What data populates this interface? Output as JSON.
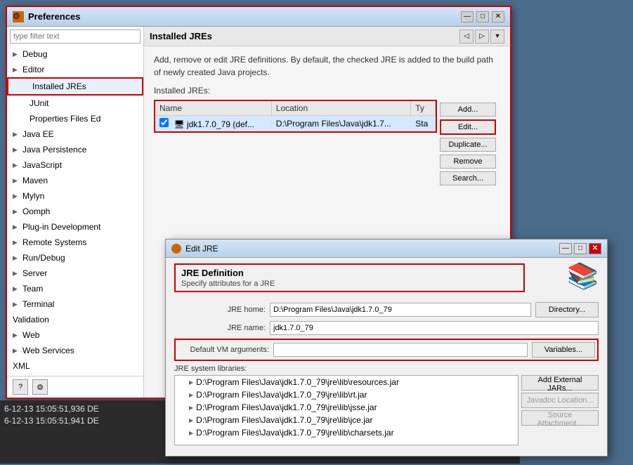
{
  "preferences_window": {
    "title": "Preferences",
    "title_icon": "⚙",
    "min_btn": "—",
    "max_btn": "□",
    "close_btn": "✕"
  },
  "filter": {
    "placeholder": "type filter text"
  },
  "sidebar": {
    "items": [
      {
        "id": "debug",
        "label": "Debug",
        "level": 0,
        "has_arrow": true,
        "arrow": "▶",
        "selected": false
      },
      {
        "id": "editor",
        "label": "Editor",
        "level": 0,
        "has_arrow": true,
        "arrow": "▶",
        "selected": false
      },
      {
        "id": "installed-jres",
        "label": "Installed JREs",
        "level": 1,
        "has_arrow": false,
        "arrow": "",
        "selected": false,
        "highlighted": true
      },
      {
        "id": "junit",
        "label": "JUnit",
        "level": 2,
        "has_arrow": false,
        "arrow": "",
        "selected": false
      },
      {
        "id": "properties-files",
        "label": "Properties Files Ed",
        "level": 2,
        "has_arrow": false,
        "arrow": "",
        "selected": false
      },
      {
        "id": "java-ee",
        "label": "Java EE",
        "level": 0,
        "has_arrow": true,
        "arrow": "▶",
        "selected": false
      },
      {
        "id": "java-persistence",
        "label": "Java Persistence",
        "level": 0,
        "has_arrow": true,
        "arrow": "▶",
        "selected": false
      },
      {
        "id": "javascript",
        "label": "JavaScript",
        "level": 0,
        "has_arrow": true,
        "arrow": "▶",
        "selected": false
      },
      {
        "id": "maven",
        "label": "Maven",
        "level": 0,
        "has_arrow": true,
        "arrow": "▶",
        "selected": false
      },
      {
        "id": "mylyn",
        "label": "Mylyn",
        "level": 0,
        "has_arrow": true,
        "arrow": "▶",
        "selected": false
      },
      {
        "id": "oomph",
        "label": "Oomph",
        "level": 0,
        "has_arrow": true,
        "arrow": "▶",
        "selected": false
      },
      {
        "id": "plugin-development",
        "label": "Plug-in Development",
        "level": 0,
        "has_arrow": true,
        "arrow": "▶",
        "selected": false
      },
      {
        "id": "remote-systems",
        "label": "Remote Systems",
        "level": 0,
        "has_arrow": true,
        "arrow": "▶",
        "selected": false
      },
      {
        "id": "run-debug",
        "label": "Run/Debug",
        "level": 0,
        "has_arrow": true,
        "arrow": "▶",
        "selected": false
      },
      {
        "id": "server",
        "label": "Server",
        "level": 0,
        "has_arrow": true,
        "arrow": "▶",
        "selected": false
      },
      {
        "id": "team",
        "label": "Team",
        "level": 0,
        "has_arrow": true,
        "arrow": "▶",
        "selected": false
      },
      {
        "id": "terminal",
        "label": "Terminal",
        "level": 0,
        "has_arrow": true,
        "arrow": "▶",
        "selected": false
      },
      {
        "id": "validation",
        "label": "Validation",
        "level": 0,
        "has_arrow": false,
        "arrow": "",
        "selected": false
      },
      {
        "id": "web",
        "label": "Web",
        "level": 0,
        "has_arrow": true,
        "arrow": "▶",
        "selected": false
      },
      {
        "id": "web-services",
        "label": "Web Services",
        "level": 0,
        "has_arrow": true,
        "arrow": "▶",
        "selected": false
      },
      {
        "id": "xml",
        "label": "XML",
        "level": 0,
        "has_arrow": false,
        "arrow": "",
        "selected": false
      }
    ],
    "help_btn": "?",
    "preferences_btn": "⚙"
  },
  "right_panel": {
    "title": "Installed JREs",
    "nav_back": "◁",
    "nav_dropdown": "▾",
    "nav_forward": "▷",
    "description": "Add, remove or edit JRE definitions. By default, the checked JRE is added to the build path of newly created Java projects.",
    "jre_list_label": "Installed JREs:",
    "columns": [
      "Name",
      "Location",
      "Ty"
    ],
    "rows": [
      {
        "checked": true,
        "icon": "🖥",
        "name": "jdk1.7.0_79 (def...",
        "location": "D:\\Program Files\\Java\\jdk1.7...",
        "type": "Sta"
      }
    ],
    "buttons": {
      "add": "Add...",
      "edit": "Edit...",
      "duplicate": "Duplicate...",
      "remove": "Remove",
      "search": "Search..."
    }
  },
  "edit_jre_dialog": {
    "title": "Edit JRE",
    "min_btn": "—",
    "max_btn": "□",
    "close_btn": "✕",
    "heading": "JRE Definition",
    "subheading": "Specify attributes for a JRE",
    "jre_home_label": "JRE home:",
    "jre_home_value": "D:\\Program Files\\Java\\jdk1.7.0_79",
    "jre_home_btn": "Directory...",
    "jre_name_label": "JRE name:",
    "jre_name_value": "jdk1.7.0_79",
    "default_vm_label": "Default VM arguments:",
    "default_vm_value": "",
    "default_vm_btn": "Variables...",
    "system_libs_label": "JRE system libraries:",
    "libraries": [
      "D:\\Program Files\\Java\\jdk1.7.0_79\\jre\\lib\\resources.jar",
      "D:\\Program Files\\Java\\jdk1.7.0_79\\jre\\lib\\rt.jar",
      "D:\\Program Files\\Java\\jdk1.7.0_79\\jre\\lib\\jsse.jar",
      "D:\\Program Files\\Java\\jdk1.7.0_79\\jre\\lib\\jce.jar",
      "D:\\Program Files\\Java\\jdk1.7.0_79\\jre\\lib\\charsets.jar"
    ],
    "lib_buttons": {
      "add_external": "Add External JARs...",
      "javadoc": "Javadoc Location...",
      "source": "Source Attachment..."
    }
  },
  "console": {
    "lines": [
      "6-12-13 15:05:51,936 DE",
      "6-12-13 15:05:51,941 DE"
    ]
  }
}
